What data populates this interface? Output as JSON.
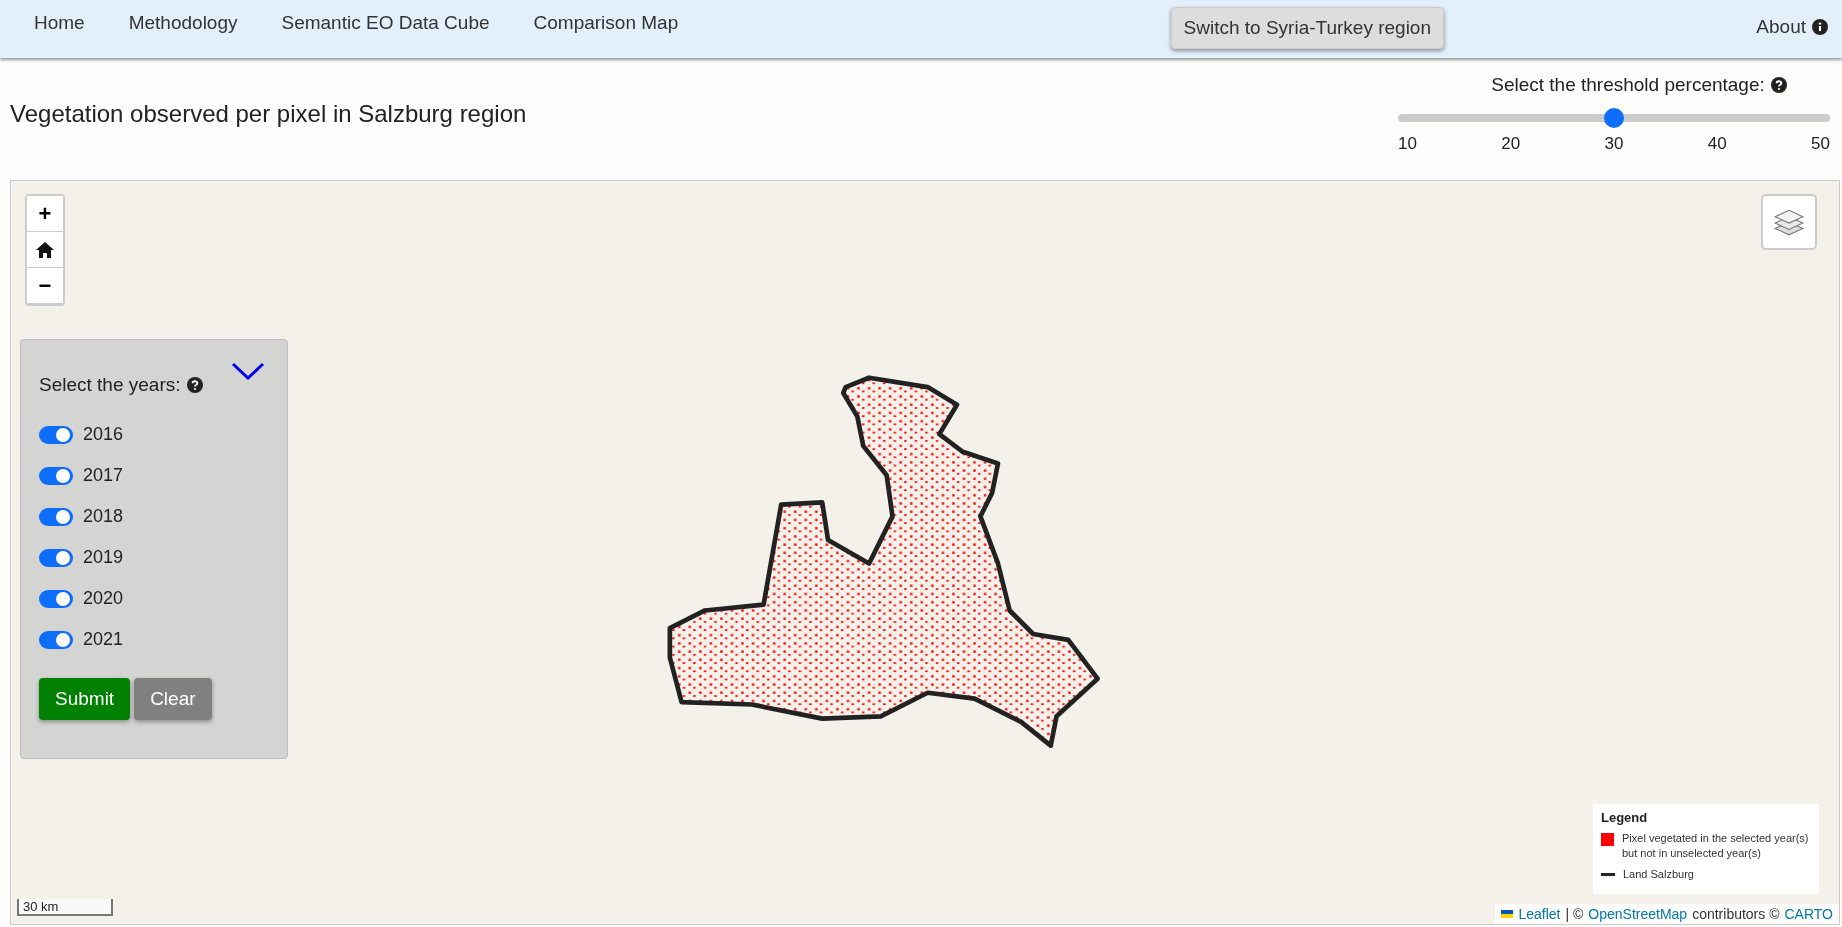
{
  "navbar": {
    "items": [
      {
        "label": "Home"
      },
      {
        "label": "Methodology"
      },
      {
        "label": "Semantic EO Data Cube"
      },
      {
        "label": "Comparison Map"
      }
    ],
    "switch_button": "Switch to Syria-Turkey region",
    "about": "About"
  },
  "title": "Vegetation observed per pixel in Salzburg region",
  "threshold": {
    "label": "Select the threshold percentage:",
    "level": 0.5,
    "ticks": [
      "10",
      "20",
      "30",
      "40",
      "50"
    ]
  },
  "map": {
    "zoom_controls": {
      "zoom_in": "+",
      "zoom_out": "−"
    },
    "years_panel": {
      "label": "Select the years:",
      "years": [
        {
          "label": "2016",
          "checked": true
        },
        {
          "label": "2017",
          "checked": true
        },
        {
          "label": "2018",
          "checked": true
        },
        {
          "label": "2019",
          "checked": true
        },
        {
          "label": "2020",
          "checked": true
        },
        {
          "label": "2021",
          "checked": true
        }
      ],
      "buttons": [
        {
          "label": "Submit",
          "kind": "primary"
        },
        {
          "label": "Clear",
          "kind": "secondary"
        }
      ]
    },
    "legend": {
      "title": "Legend",
      "items": [
        {
          "kind": "square",
          "color": "#ff0000",
          "label": "Pixel vegetated in the selected year(s) but not in unselected year(s)"
        },
        {
          "kind": "line",
          "color": "#222222",
          "label": "Land Salzburg"
        }
      ]
    },
    "scale": "30 km",
    "attribution": {
      "leaflet": "Leaflet",
      "sep": "| ©",
      "osm": "OpenStreetMap",
      "mid": "contributors ©",
      "carto": "CARTO"
    }
  }
}
